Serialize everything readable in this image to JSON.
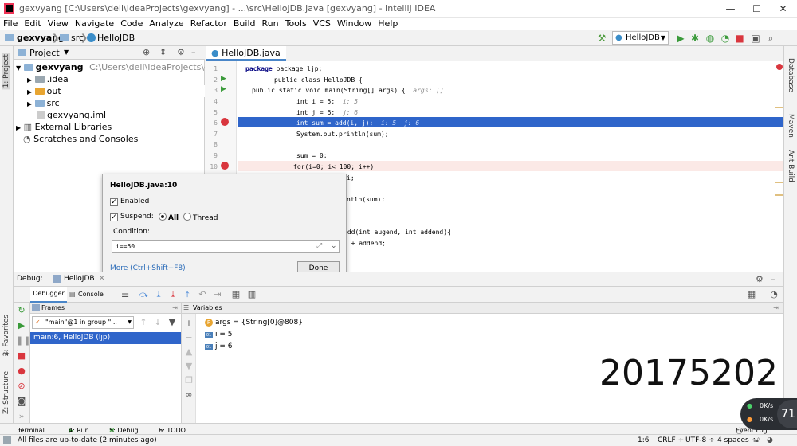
{
  "window": {
    "title": "gexvyang [C:\\Users\\dell\\IdeaProjects\\gexvyang] - ...\\src\\HelloJDB.java [gexvyang] - IntelliJ IDEA",
    "minimize": "—",
    "maximize": "☐",
    "close": "✕"
  },
  "menu": [
    "File",
    "Edit",
    "View",
    "Navigate",
    "Code",
    "Analyze",
    "Refactor",
    "Build",
    "Run",
    "Tools",
    "VCS",
    "Window",
    "Help"
  ],
  "breadcrumb": {
    "project": "gexvyang",
    "folder": "src",
    "file": "HelloJDB"
  },
  "toolbar": {
    "run_config": "HelloJDB"
  },
  "left_strip": {
    "project": "1: Project",
    "favorites": "2: Favorites",
    "structure": "Z: Structure"
  },
  "right_strip": {
    "database": "Database",
    "maven": "Maven",
    "ant": "Ant Build"
  },
  "project_panel": {
    "title": "Project",
    "root": "gexvyang",
    "root_path": "C:\\Users\\dell\\IdeaProjects\\gexvyang",
    "items": [
      ".idea",
      "out",
      "src",
      "gexvyang.iml"
    ],
    "external": "External Libraries",
    "scratches": "Scratches and Consoles"
  },
  "editor": {
    "tab": "HelloJDB.java",
    "line_numbers": [
      "1",
      "2",
      "3",
      "4",
      "5",
      "6",
      "7",
      "8",
      "9",
      "10"
    ],
    "lines": {
      "l1": "package ljp;",
      "l2": "public class HelloJDB {",
      "l3": "public static void main(String[] args) {",
      "l3_hint": "args: []",
      "l4": "int i = 5;",
      "l4_hint": "i: 5",
      "l5": "int j = 6;",
      "l5_hint": "j: 6",
      "l6": "int sum = add(i, j);",
      "l6_hint": "i: 5  j: 6",
      "l7": "System.out.println(sum);",
      "l9": "sum = 0;",
      "l10": "for(i=0; i< 100; i++)",
      "l11_tail": "i;",
      "l13_tail": "ntln(sum);",
      "l15_tail": "add(int augend, int addend){",
      "l16_tail": "d + addend;"
    }
  },
  "breakpoint_popup": {
    "title": "HelloJDB.java:10",
    "enabled": "Enabled",
    "suspend": "Suspend:",
    "all": "All",
    "thread": "Thread",
    "condition_label": "Condition:",
    "condition_value": "i==50",
    "more": "More (Ctrl+Shift+F8)",
    "done": "Done"
  },
  "debug": {
    "label": "Debug:",
    "session": "HelloJDB",
    "tab_debugger": "Debugger",
    "tab_console": "Console",
    "frames_title": "Frames",
    "thread": "\"main\"@1 in group \"...",
    "frame": "main:6, HelloJDB (ljp)",
    "variables_title": "Variables",
    "vars": [
      {
        "icon": "P",
        "text": "args = {String[0]@808}"
      },
      {
        "icon": "01",
        "text": "i = 5"
      },
      {
        "icon": "01",
        "text": "j = 6"
      }
    ],
    "watermark": "20175202"
  },
  "bottom_tabs": {
    "terminal": "Terminal",
    "run": "4: Run",
    "debug": "5: Debug",
    "todo": "6: TODO",
    "event_log": "Event Log"
  },
  "status": {
    "message": "All files are up-to-date (2 minutes ago)",
    "position": "1:6",
    "line_sep": "CRLF ÷",
    "encoding": "UTF-8 ÷",
    "indent": "4 spaces ÷"
  },
  "net_widget": {
    "up": "0K/s",
    "down": "0K/s",
    "percent": "71"
  }
}
